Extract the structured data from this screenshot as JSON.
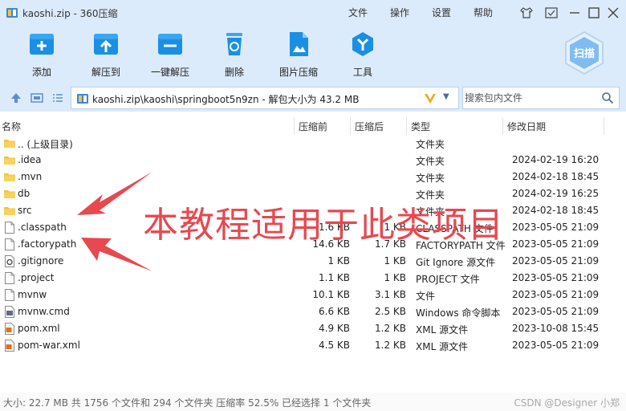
{
  "window": {
    "title": "kaoshi.zip - 360压缩"
  },
  "menu": [
    "文件",
    "操作",
    "设置",
    "帮助"
  ],
  "toolbar": [
    {
      "label": "添加",
      "icon": "add-icon"
    },
    {
      "label": "解压到",
      "icon": "extract-to-icon"
    },
    {
      "label": "一键解压",
      "icon": "one-click-extract-icon"
    },
    {
      "label": "删除",
      "icon": "delete-icon"
    },
    {
      "label": "图片压缩",
      "icon": "image-compress-icon"
    },
    {
      "label": "工具",
      "icon": "tools-icon"
    }
  ],
  "scan": {
    "label": "扫描"
  },
  "address": {
    "path": "kaoshi.zip\\kaoshi\\springboot5n9zn - 解包大小为 43.2 MB"
  },
  "search": {
    "placeholder": "搜索包内文件"
  },
  "columns": {
    "name": "名称",
    "size": "压缩前",
    "compressed": "压缩后",
    "type": "类型",
    "modified": "修改日期"
  },
  "files": [
    {
      "name": ".. (上级目录)",
      "size": "",
      "compressed": "",
      "type": "文件夹",
      "date": "",
      "icon": "folder"
    },
    {
      "name": ".idea",
      "size": "",
      "compressed": "",
      "type": "文件夹",
      "date": "2024-02-19 16:20",
      "icon": "folder"
    },
    {
      "name": ".mvn",
      "size": "",
      "compressed": "",
      "type": "文件夹",
      "date": "2024-02-18 18:45",
      "icon": "folder"
    },
    {
      "name": "db",
      "size": "",
      "compressed": "",
      "type": "文件夹",
      "date": "2024-02-19 16:25",
      "icon": "folder"
    },
    {
      "name": "src",
      "size": "",
      "compressed": "",
      "type": "文件夹",
      "date": "2024-02-18 18:45",
      "icon": "folder"
    },
    {
      "name": ".classpath",
      "size": "1.6 KB",
      "compressed": "1 KB",
      "type": "CLASSPATH 文件",
      "date": "2023-05-05 21:09",
      "icon": "file"
    },
    {
      "name": ".factorypath",
      "size": "14.6 KB",
      "compressed": "1.7 KB",
      "type": "FACTORYPATH 文件",
      "date": "2023-05-05 21:09",
      "icon": "file"
    },
    {
      "name": ".gitignore",
      "size": "1 KB",
      "compressed": "1 KB",
      "type": "Git Ignore 源文件",
      "date": "2023-05-05 21:09",
      "icon": "gear-file"
    },
    {
      "name": ".project",
      "size": "1.1 KB",
      "compressed": "1 KB",
      "type": "PROJECT 文件",
      "date": "2023-05-05 21:09",
      "icon": "file"
    },
    {
      "name": "mvnw",
      "size": "10.1 KB",
      "compressed": "3.1 KB",
      "type": "文件",
      "date": "2023-05-05 21:09",
      "icon": "file"
    },
    {
      "name": "mvnw.cmd",
      "size": "6.6 KB",
      "compressed": "2.5 KB",
      "type": "Windows 命令脚本",
      "date": "2023-05-05 21:09",
      "icon": "cmd-file"
    },
    {
      "name": "pom.xml",
      "size": "4.9 KB",
      "compressed": "1.2 KB",
      "type": "XML 源文件",
      "date": "2023-10-08 15:45",
      "icon": "xml-file"
    },
    {
      "name": "pom-war.xml",
      "size": "4.5 KB",
      "compressed": "1.2 KB",
      "type": "XML 源文件",
      "date": "2023-05-05 21:09",
      "icon": "xml-file"
    }
  ],
  "status": {
    "text": "大小: 22.7 MB 共 1756 个文件和 294 个文件夹 压缩率 52.5% 已经选择 1 个文件夹"
  },
  "watermark": "CSDN @Designer 小郑",
  "overlay": {
    "text": "本教程适用于此类项目",
    "color": "#e8484f"
  },
  "colors": {
    "accent": "#1a8fe3",
    "toolbar_bg": "#dcebfb",
    "folder": "#f5c33c",
    "annotation": "#e8484f"
  }
}
